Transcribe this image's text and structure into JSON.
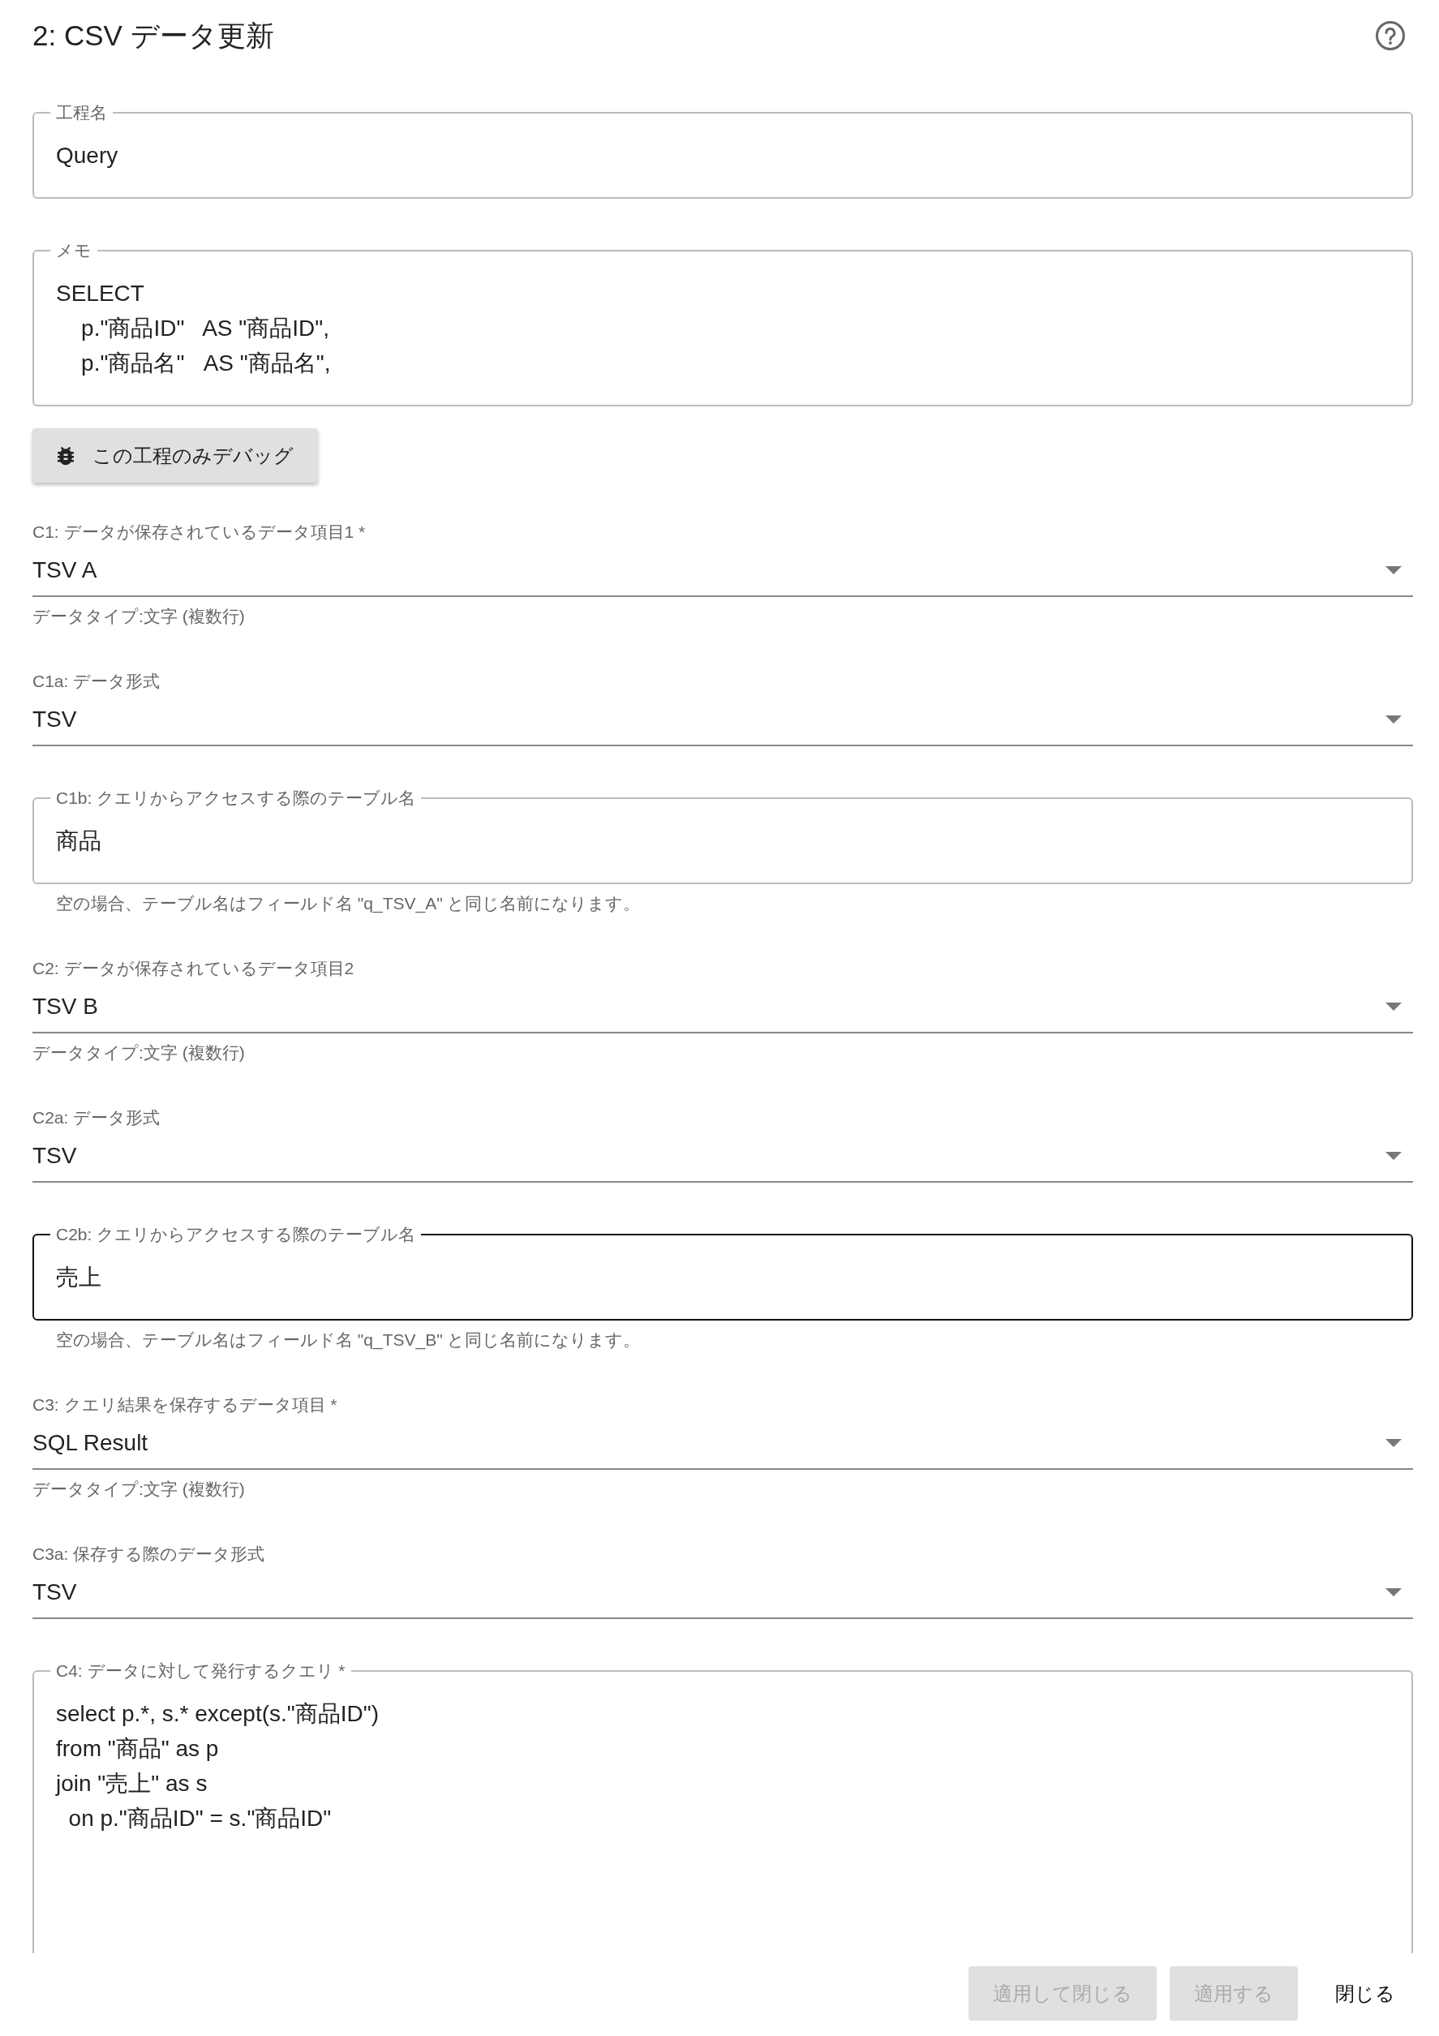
{
  "title": "2: CSV データ更新",
  "fields": [
    {
      "kind": "outlined",
      "label": "工程名",
      "value": "Query",
      "focused": false
    },
    {
      "kind": "multiline",
      "label": "メモ",
      "lines": [
        "SELECT",
        "    p.\"商品ID\"   AS \"商品ID\",",
        "    p.\"商品名\"   AS \"商品名\","
      ]
    },
    {
      "kind": "button",
      "label": "この工程のみデバッグ"
    },
    {
      "kind": "select",
      "label": "C1: データが保存されているデータ項目1 *",
      "value": "TSV A",
      "hint": "データタイプ:文字 (複数行)"
    },
    {
      "kind": "select",
      "label": "C1a: データ形式",
      "value": "TSV"
    },
    {
      "kind": "outlined",
      "label": "C1b: クエリからアクセスする際のテーブル名",
      "value": "商品",
      "focused": false,
      "hint": "空の場合、テーブル名はフィールド名 \"q_TSV_A\" と同じ名前になります。"
    },
    {
      "kind": "select",
      "label": "C2: データが保存されているデータ項目2",
      "value": "TSV B",
      "hint": "データタイプ:文字 (複数行)"
    },
    {
      "kind": "select",
      "label": "C2a: データ形式",
      "value": "TSV"
    },
    {
      "kind": "outlined",
      "label": "C2b: クエリからアクセスする際のテーブル名",
      "value": "売上",
      "focused": true,
      "hint": "空の場合、テーブル名はフィールド名 \"q_TSV_B\" と同じ名前になります。"
    },
    {
      "kind": "select",
      "label": "C3: クエリ結果を保存するデータ項目 *",
      "value": "SQL Result",
      "hint": "データタイプ:文字 (複数行)"
    },
    {
      "kind": "select",
      "label": "C3a: 保存する際のデータ形式",
      "value": "TSV"
    },
    {
      "kind": "query",
      "label": "C4: データに対して発行するクエリ *",
      "lines": [
        "select p.*, s.* except(s.\"商品ID\")",
        "from \"商品\" as p",
        "join \"売上\" as s",
        "  on p.\"商品ID\" = s.\"商品ID\""
      ]
    }
  ],
  "footer_buttons": [
    {
      "label": "適用して閉じる",
      "disabled": true
    },
    {
      "label": "適用する",
      "disabled": true
    },
    {
      "label": "閉じる",
      "disabled": false
    }
  ]
}
